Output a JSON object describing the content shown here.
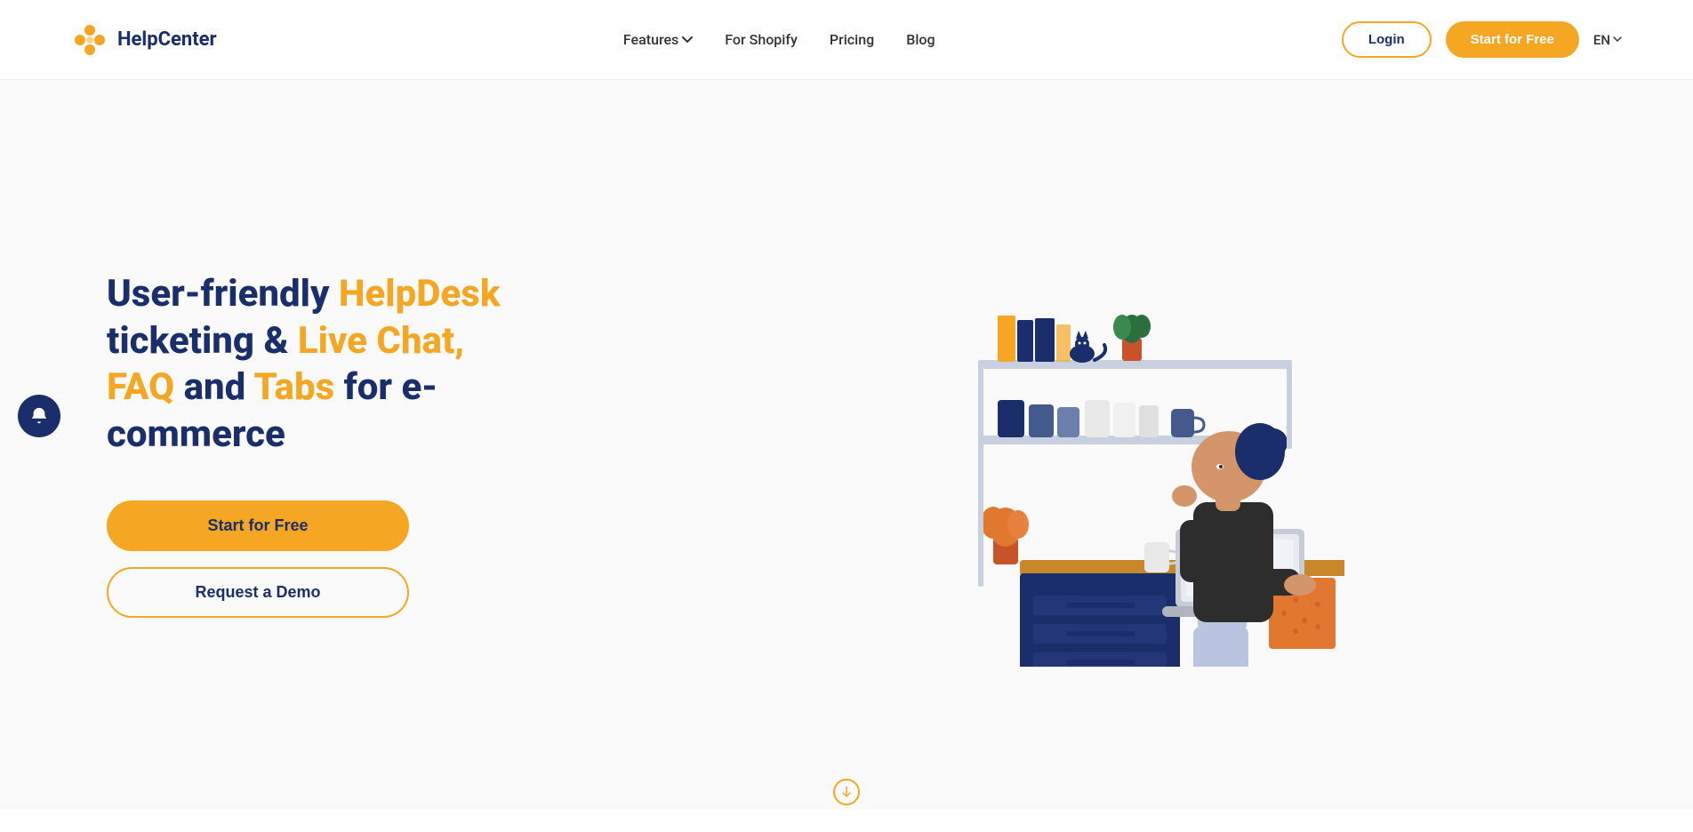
{
  "nav": {
    "logo_text": "HelpCenter",
    "links": [
      {
        "label": "Features",
        "has_dropdown": true
      },
      {
        "label": "For Shopify"
      },
      {
        "label": "Pricing"
      },
      {
        "label": "Blog"
      }
    ],
    "login_label": "Login",
    "start_free_label": "Start for Free",
    "lang": "EN"
  },
  "hero": {
    "heading_part1": "User-friendly ",
    "heading_orange1": "HelpDesk",
    "heading_part2": " ticketing & ",
    "heading_orange2": "Live Chat, FAQ",
    "heading_part3": " and ",
    "heading_orange3": "Tabs",
    "heading_part4": " for e-commerce",
    "cta_primary": "Start for Free",
    "cta_secondary": "Request a Demo"
  },
  "notification": {
    "label": "bell-icon"
  },
  "scroll": {
    "label": "scroll-down"
  },
  "colors": {
    "brand_blue": "#1a2e6b",
    "brand_orange": "#f5a623"
  }
}
